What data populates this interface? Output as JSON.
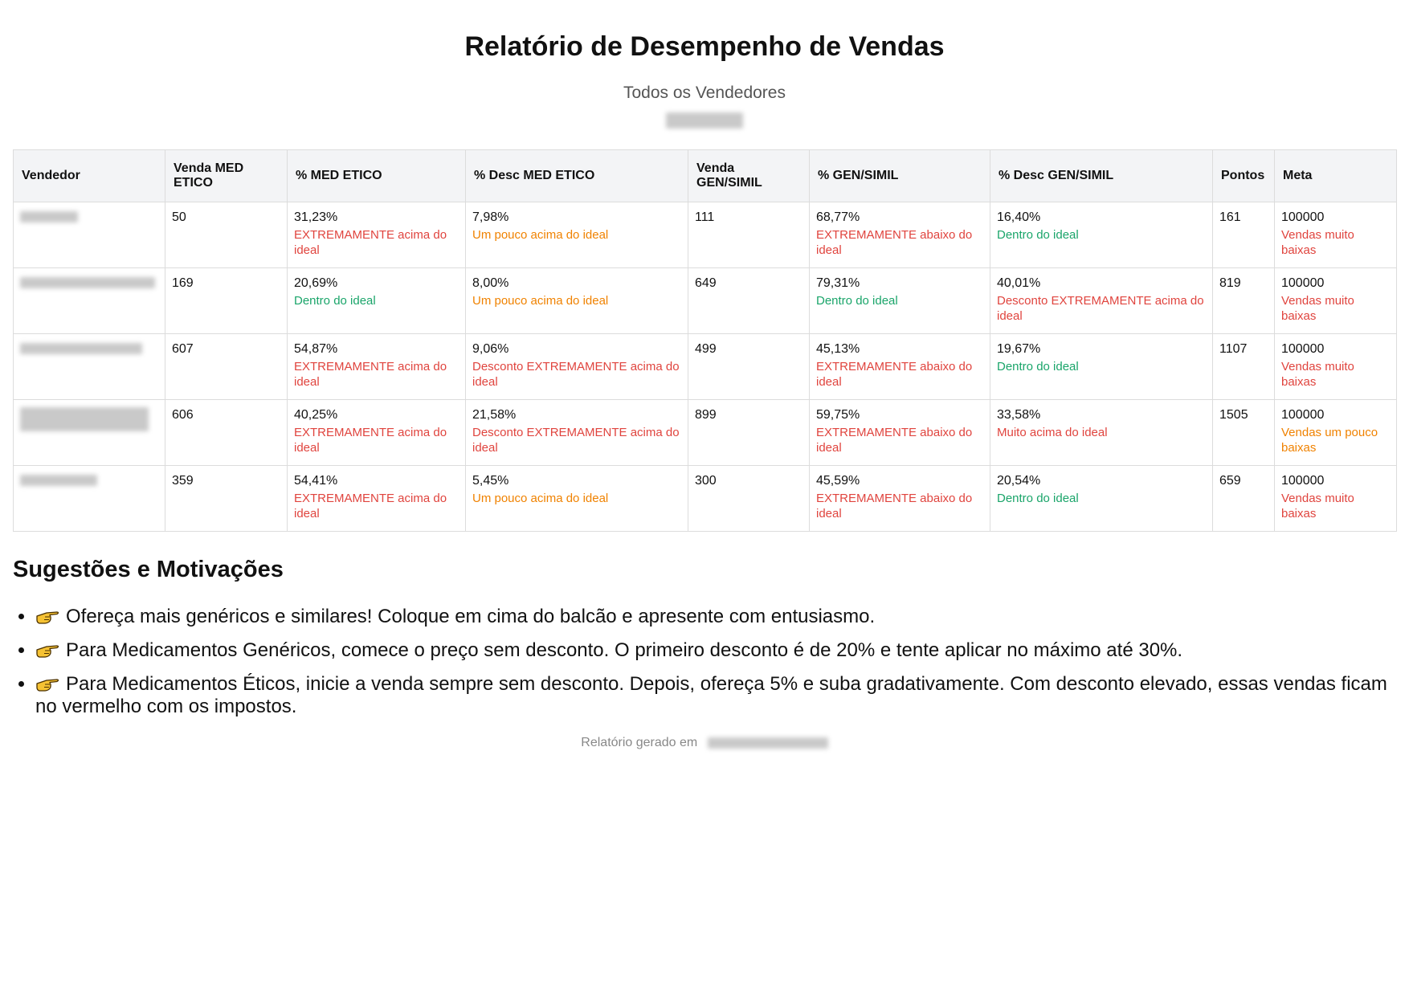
{
  "report": {
    "title": "Relatório de Desempenho de Vendas",
    "subtitle": "Todos os Vendedores"
  },
  "colors": {
    "red": "#e0443e",
    "orange": "#f08200",
    "green": "#1aa56a",
    "header_bg": "#f3f4f6"
  },
  "table": {
    "headers": [
      "Vendedor",
      "Venda MED ETICO",
      "% MED ETICO",
      "% Desc MED ETICO",
      "Venda GEN/SIMIL",
      "% GEN/SIMIL",
      "% Desc GEN/SIMIL",
      "Pontos",
      "Meta"
    ],
    "rows": [
      {
        "venda_med": "50",
        "pct_med": "31,23%",
        "pct_med_status": "EXTREMAMENTE acima do ideal",
        "desc_med": "7,98%",
        "desc_med_status": "Um pouco acima do ideal",
        "venda_gen": "111",
        "pct_gen": "68,77%",
        "pct_gen_status": "EXTREMAMENTE abaixo do ideal",
        "desc_gen": "16,40%",
        "desc_gen_status": "Dentro do ideal",
        "pontos": "161",
        "meta": "100000",
        "meta_status": "Vendas muito baixas"
      },
      {
        "venda_med": "169",
        "pct_med": "20,69%",
        "pct_med_status": "Dentro do ideal",
        "desc_med": "8,00%",
        "desc_med_status": "Um pouco acima do ideal",
        "venda_gen": "649",
        "pct_gen": "79,31%",
        "pct_gen_status": "Dentro do ideal",
        "desc_gen": "40,01%",
        "desc_gen_status": "Desconto EXTREMAMENTE acima do ideal",
        "pontos": "819",
        "meta": "100000",
        "meta_status": "Vendas muito baixas"
      },
      {
        "venda_med": "607",
        "pct_med": "54,87%",
        "pct_med_status": "EXTREMAMENTE acima do ideal",
        "desc_med": "9,06%",
        "desc_med_status": "Desconto EXTREMAMENTE acima do ideal",
        "venda_gen": "499",
        "pct_gen": "45,13%",
        "pct_gen_status": "EXTREMAMENTE abaixo do ideal",
        "desc_gen": "19,67%",
        "desc_gen_status": "Dentro do ideal",
        "pontos": "1107",
        "meta": "100000",
        "meta_status": "Vendas muito baixas"
      },
      {
        "venda_med": "606",
        "pct_med": "40,25%",
        "pct_med_status": "EXTREMAMENTE acima do ideal",
        "desc_med": "21,58%",
        "desc_med_status": "Desconto EXTREMAMENTE acima do ideal",
        "venda_gen": "899",
        "pct_gen": "59,75%",
        "pct_gen_status": "EXTREMAMENTE abaixo do ideal",
        "desc_gen": "33,58%",
        "desc_gen_status": "Muito acima do ideal",
        "pontos": "1505",
        "meta": "100000",
        "meta_status": "Vendas um pouco baixas"
      },
      {
        "venda_med": "359",
        "pct_med": "54,41%",
        "pct_med_status": "EXTREMAMENTE acima do ideal",
        "desc_med": "5,45%",
        "desc_med_status": "Um pouco acima do ideal",
        "venda_gen": "300",
        "pct_gen": "45,59%",
        "pct_gen_status": "EXTREMAMENTE abaixo do ideal",
        "desc_gen": "20,54%",
        "desc_gen_status": "Dentro do ideal",
        "pontos": "659",
        "meta": "100000",
        "meta_status": "Vendas muito baixas"
      }
    ]
  },
  "suggestions": {
    "title": "Sugestões e Motivações",
    "icon": "pointing-hand-icon",
    "items": [
      "Ofereça mais genéricos e similares! Coloque em cima do balcão e apresente com entusiasmo.",
      "Para Medicamentos Genéricos, comece o preço sem desconto. O primeiro desconto é de 20% e tente aplicar no máximo até 30%.",
      "Para Medicamentos Éticos, inicie a venda sempre sem desconto. Depois, ofereça 5% e suba gradativamente. Com desconto elevado, essas vendas ficam no vermelho com os impostos."
    ]
  },
  "footer": {
    "label": "Relatório gerado em"
  }
}
